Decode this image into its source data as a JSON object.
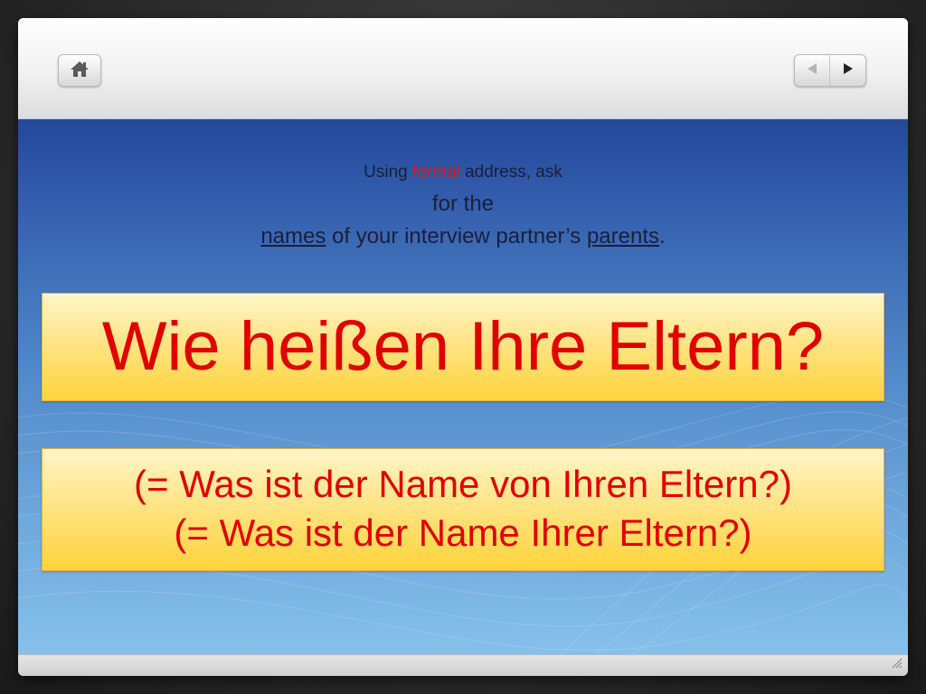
{
  "toolbar": {
    "home_icon": "home-icon",
    "prev_icon": "triangle-left-icon",
    "next_icon": "triangle-right-icon"
  },
  "slide": {
    "instruction": {
      "line1_pre": "Using ",
      "line1_highlight": "formal",
      "line1_post": " address, ask",
      "line2": "for the",
      "line3_word1": "names",
      "line3_mid": " of your interview partner’s ",
      "line3_word2": "parents",
      "line3_end": "."
    },
    "main_question": "Wie heißen Ihre Eltern?",
    "alt_line1": "(= Was ist der Name von Ihren Eltern?)",
    "alt_line2": "(= Was ist der Name Ihrer Eltern?)"
  },
  "colors": {
    "highlight_red": "#cc1f1f",
    "question_red": "#e00000",
    "box_yellow": "#ffd33b",
    "background_blue": "#3662b0"
  }
}
